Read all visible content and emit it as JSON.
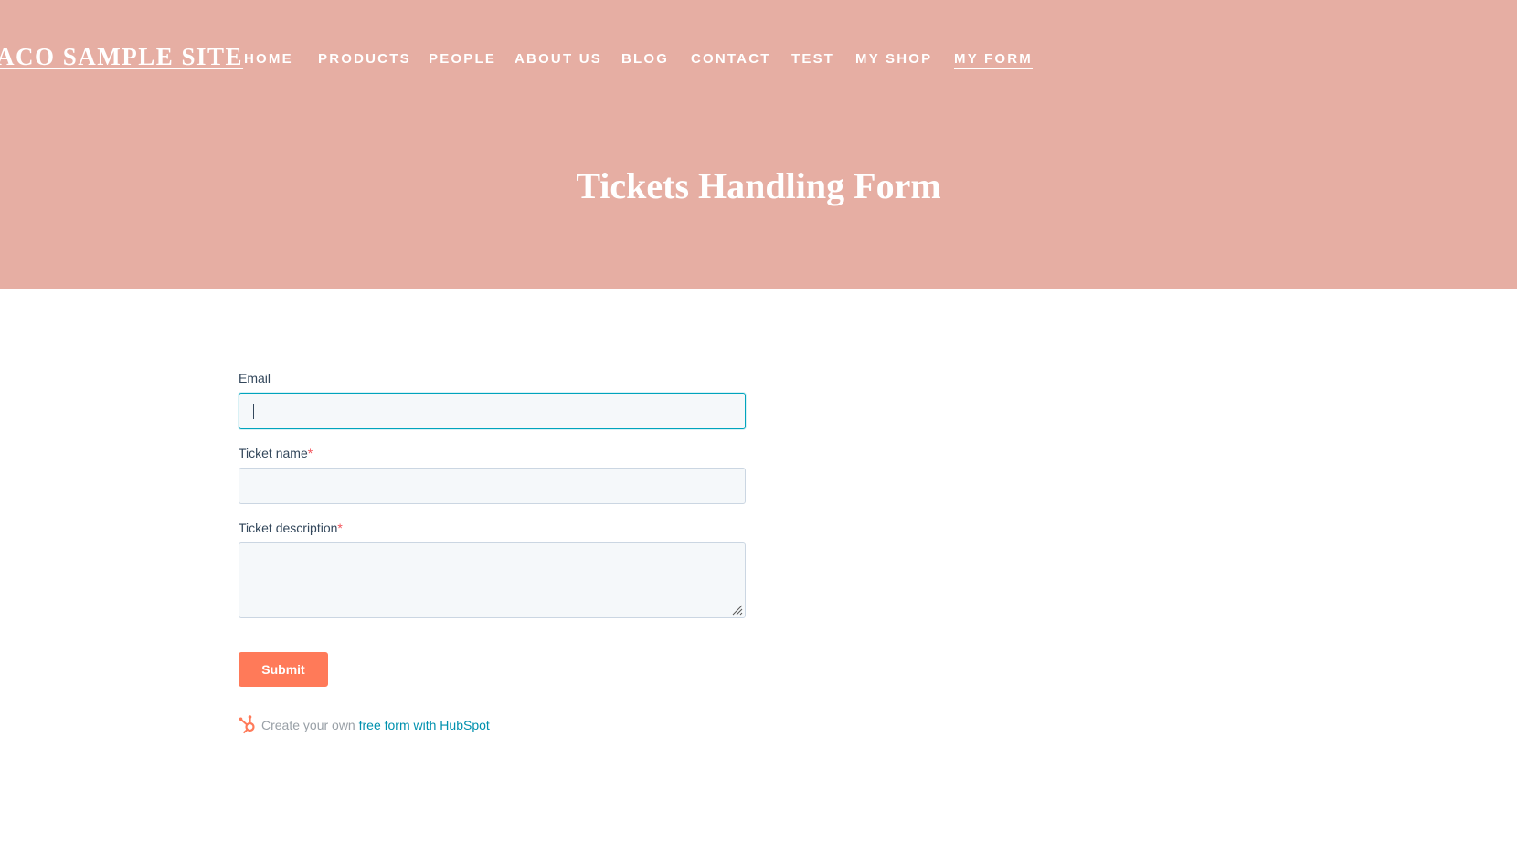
{
  "header": {
    "site_title": "ACO SAMPLE SITE",
    "nav": [
      {
        "label": "HOME"
      },
      {
        "label": "PRODUCTS"
      },
      {
        "label": "PEOPLE"
      },
      {
        "label": "ABOUT US"
      },
      {
        "label": "BLOG"
      },
      {
        "label": "CONTACT"
      },
      {
        "label": "TEST"
      },
      {
        "label": "MY SHOP"
      },
      {
        "label": "MY FORM",
        "active": true
      }
    ],
    "page_title": "Tickets Handling Form",
    "bg_color": "#e6aea3"
  },
  "form": {
    "fields": [
      {
        "label": "Email",
        "required": false,
        "value": "",
        "type": "text",
        "focused": true
      },
      {
        "label": "Ticket name",
        "required": true,
        "value": "",
        "type": "text"
      },
      {
        "label": "Ticket description",
        "required": true,
        "value": "",
        "type": "textarea"
      }
    ],
    "required_mark": "*",
    "submit_label": "Submit",
    "submit_color": "#ff7a59"
  },
  "footer": {
    "prefix": "Create your own ",
    "link_text": "free form with HubSpot",
    "icon": "hubspot-sprocket-icon"
  }
}
